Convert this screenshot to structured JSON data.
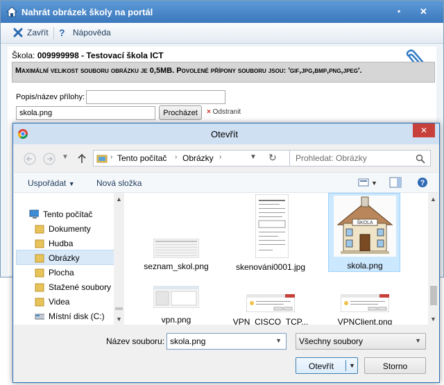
{
  "portal": {
    "title": "Nahrát obrázek školy na portál",
    "title_buttons": [
      "▪",
      "✕"
    ],
    "toolbar": {
      "close_label": "Zavřít",
      "help_label": "Nápověda"
    },
    "school_label": "Škola:",
    "school_value": "009999998 - Testovací škola ICT",
    "info_text": "Maximální velikost souboru obrázku je 0,5MB. Povolené přípony souboru jsou: 'gif,jpg,bmp,png,jpeg'.",
    "description_label": "Popis/název přílohy:",
    "description_value": "",
    "file_value": "skola.png",
    "browse_label": "Procházet",
    "remove_label": "Odstranit"
  },
  "dialog": {
    "title": "Otevřít",
    "close_glyph": "✕",
    "breadcrumb": [
      "Tento počítač",
      "Obrázky"
    ],
    "search_placeholder": "Prohledat: Obrázky",
    "organize_label": "Uspořádat",
    "new_folder_label": "Nová složka",
    "nav_items": [
      {
        "label": "Tento počítač",
        "icon": "computer-icon"
      },
      {
        "label": "Dokumenty",
        "icon": "folder-icon"
      },
      {
        "label": "Hudba",
        "icon": "folder-icon"
      },
      {
        "label": "Obrázky",
        "icon": "folder-icon"
      },
      {
        "label": "Plocha",
        "icon": "folder-icon"
      },
      {
        "label": "Stažené soubory",
        "icon": "folder-icon"
      },
      {
        "label": "Videa",
        "icon": "folder-icon"
      },
      {
        "label": "Místní disk (C:)",
        "icon": "drive-icon"
      }
    ],
    "files": [
      {
        "name": "seznam_skol.png"
      },
      {
        "name": "skenováni0001.jpg"
      },
      {
        "name": "skola.png"
      },
      {
        "name": "vpn.png"
      },
      {
        "name": "VPN_CISCO_TCP..."
      },
      {
        "name": "VPNClient.png"
      }
    ],
    "school_sign": "ŠKOLA",
    "filename_label": "Název souboru:",
    "filename_value": "skola.png",
    "filter_value": "Všechny soubory",
    "open_label": "Otevřít",
    "cancel_label": "Storno"
  },
  "colors": {
    "accent": "#3b78bd",
    "selected": "#cce8ff",
    "close_red": "#c7403a"
  }
}
